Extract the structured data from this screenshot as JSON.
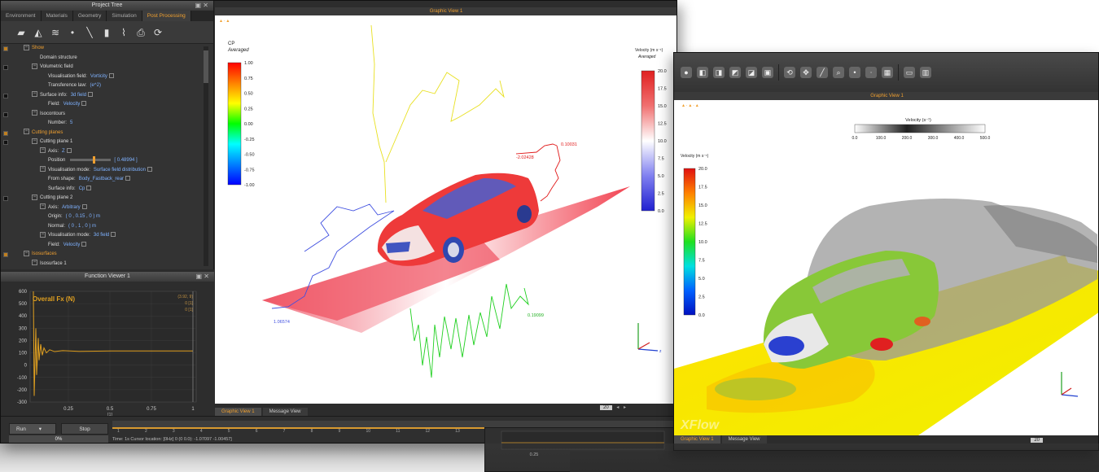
{
  "tree_panel": {
    "title": "Project Tree",
    "tabs": [
      "Environment",
      "Materials",
      "Geometry",
      "Simulation",
      "Post Processing"
    ],
    "rows": [
      {
        "label": "Show",
        "section": true,
        "indent": 0
      },
      {
        "label": "Domain structure",
        "indent": 2
      },
      {
        "label": "Volumetric field",
        "indent": 1,
        "exp": true
      },
      {
        "label": "Visualisation field:",
        "value": "Vorticity",
        "indent": 3
      },
      {
        "label": "Transference law:",
        "value": "(e^2)",
        "indent": 3
      },
      {
        "label": "Surface info:",
        "value": "3d field",
        "indent": 1,
        "exp": true
      },
      {
        "label": "Field:",
        "value": "Velocity",
        "indent": 3
      },
      {
        "label": "Isocontours",
        "indent": 1,
        "exp": true
      },
      {
        "label": "Number:",
        "value": "5",
        "indent": 3
      },
      {
        "label": "Cutting planes",
        "section": true,
        "indent": 0
      },
      {
        "label": "Cutting plane 1",
        "indent": 1,
        "exp": true
      },
      {
        "label": "Axis:",
        "value": "Z",
        "indent": 2,
        "exp": true
      },
      {
        "label": "Position",
        "value": "[ 0.48994 ]",
        "indent": 3,
        "slider": true
      },
      {
        "label": "Visualisation mode:",
        "value": "Surface field distribution",
        "indent": 2,
        "exp": true
      },
      {
        "label": "From shape:",
        "value": "Body_Fastback_rear",
        "indent": 3
      },
      {
        "label": "Surface info:",
        "value": "Cp",
        "indent": 3
      },
      {
        "label": "Cutting plane 2",
        "indent": 1,
        "exp": true
      },
      {
        "label": "Axis:",
        "value": "Arbitrary",
        "indent": 2,
        "exp": true
      },
      {
        "label": "Origin:",
        "value": "( 0 , 0.15 , 0 )  m",
        "indent": 3
      },
      {
        "label": "Normal:",
        "value": "( 0 , 1 , 0 )  m",
        "indent": 3
      },
      {
        "label": "Visualisation mode:",
        "value": "3d field",
        "indent": 2,
        "exp": true
      },
      {
        "label": "Field:",
        "value": "Velocity",
        "indent": 3
      },
      {
        "label": "Isosurfaces",
        "section": true,
        "indent": 0
      },
      {
        "label": "Isosurface 1",
        "indent": 1,
        "exp": true
      },
      {
        "label": "Field:",
        "value": "Total pressure",
        "indent": 2
      },
      {
        "label": "Value:",
        "value": "0",
        "indent": 2
      }
    ]
  },
  "function_viewer": {
    "title": "Function Viewer 1",
    "series_label": "Overall Fx (N)",
    "side_labels": [
      "(3.92, 9)",
      "0 [1]",
      "0 [1]"
    ],
    "x_ticks": [
      "0.25",
      "0.5",
      "0.75",
      "1"
    ],
    "x_unit": "[1]",
    "y_ticks": [
      "600",
      "500",
      "400",
      "300",
      "200",
      "100",
      "0",
      "-100",
      "-200",
      "-300"
    ]
  },
  "graphic_left": {
    "title": "Graphic View 1",
    "cp_legend": {
      "title": "CP",
      "subtitle": "Averaged",
      "ticks": [
        "1.00",
        "0.75",
        "0.50",
        "0.25",
        "0.00",
        "-0.25",
        "-0.50",
        "-0.75",
        "-1.00"
      ]
    },
    "vel_legend": {
      "title": "Velocity (m s⁻¹)",
      "subtitle": "Averaged",
      "ticks": [
        "20.0",
        "17.5",
        "15.0",
        "12.5",
        "10.0",
        "7.5",
        "5.0",
        "2.5",
        "0.0"
      ]
    },
    "probe_labels": [
      "-2.02428",
      "0.10031",
      "0.19099",
      "1.06574"
    ],
    "tabs": [
      "Graphic View 1",
      "Message View"
    ]
  },
  "timeline_left": {
    "run_label": "Run",
    "stop_label": "Stop",
    "progress": "0%",
    "status": "Time: 1s  Cursor location: [0Hz] 0 (0 0.0): -1.07097 -1.00457]",
    "ticks": [
      "1",
      "2",
      "3",
      "4",
      "5",
      "6",
      "7",
      "8",
      "9",
      "10",
      "11",
      "12",
      "13",
      "14",
      "15",
      "16",
      "17",
      "18",
      "19",
      "20"
    ],
    "frame_value": "20"
  },
  "graphic_right": {
    "title": "Graphic View 1",
    "top_legend": {
      "title": "Velocity (s⁻¹)",
      "ticks": [
        "0.0",
        "100.0",
        "200.0",
        "300.0",
        "400.0",
        "500.0"
      ]
    },
    "vel_legend": {
      "title": "Velocity (m s⁻¹)",
      "ticks": [
        "20.0",
        "17.5",
        "15.0",
        "12.5",
        "10.0",
        "7.5",
        "5.0",
        "2.5",
        "0.0"
      ]
    },
    "watermark": "XFlow",
    "tabs": [
      "Graphic View 1",
      "Message View"
    ],
    "frame_value": "20"
  },
  "bottom_strip": {
    "x_ticks": [
      "0.25",
      "0.5",
      "0.75",
      "1"
    ],
    "x_unit": "[1]"
  },
  "colors": {
    "accent": "#f0a030",
    "panel_bg": "#333333",
    "series_fx": "#e0a020"
  },
  "icons": [
    "view-front-icon",
    "view-side-icon",
    "view-iso-icon",
    "point-icon",
    "line-icon",
    "plane-icon",
    "graph-icon",
    "camera-icon",
    "refresh-icon"
  ]
}
